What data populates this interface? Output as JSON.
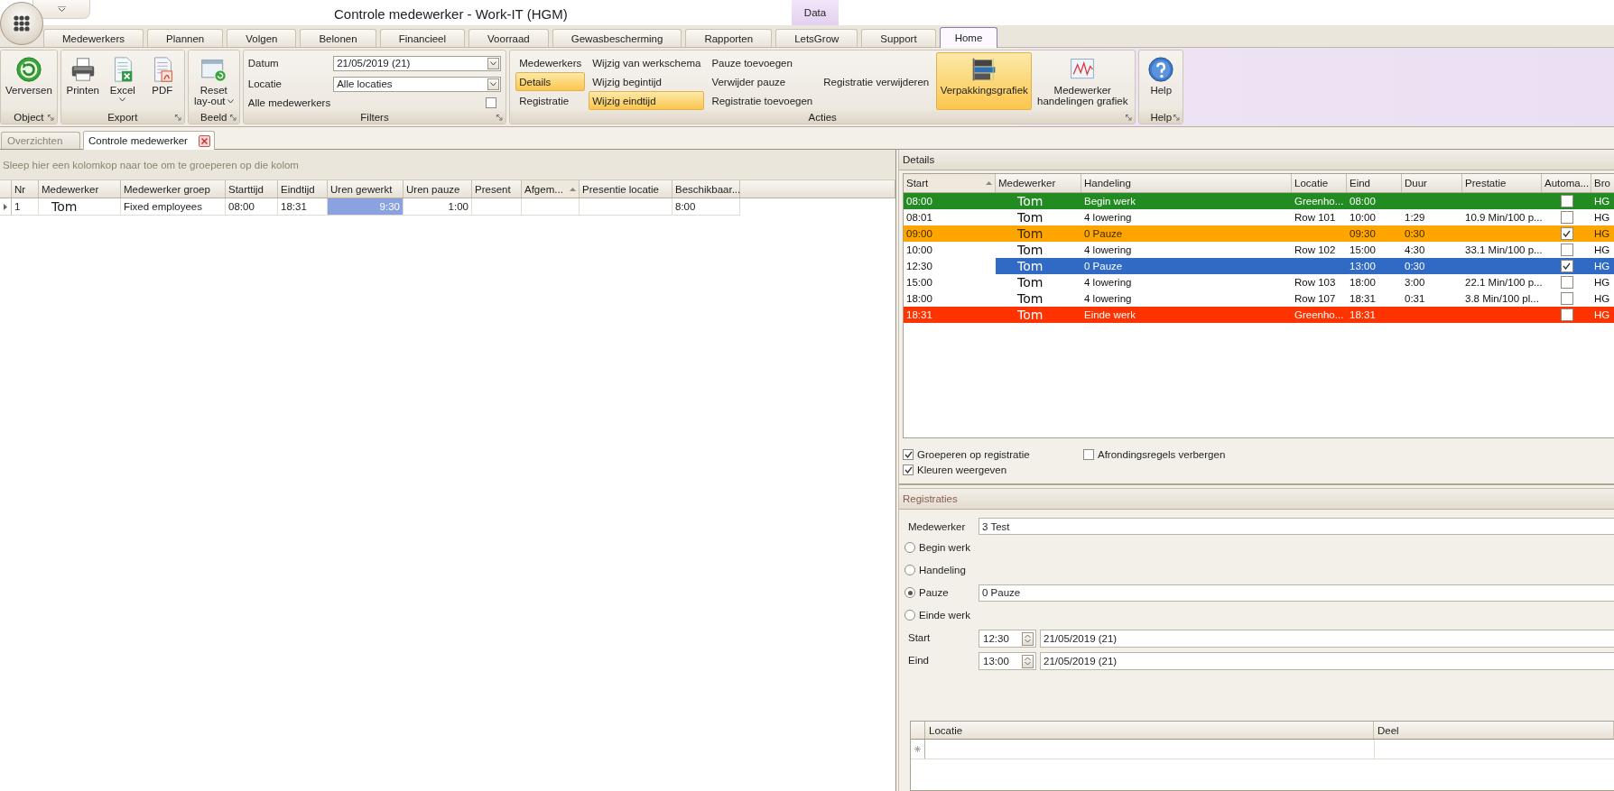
{
  "window": {
    "title": "Controle medewerker - Work-IT (HGM)",
    "contextual_tab": "Data"
  },
  "ribbon": {
    "tabs": [
      {
        "label": "Medewerkers",
        "selected": false
      },
      {
        "label": "Plannen",
        "selected": false
      },
      {
        "label": "Volgen",
        "selected": false
      },
      {
        "label": "Belonen",
        "selected": false
      },
      {
        "label": "Financieel",
        "selected": false
      },
      {
        "label": "Voorraad",
        "selected": false
      },
      {
        "label": "Gewasbescherming",
        "selected": false
      },
      {
        "label": "Rapporten",
        "selected": false
      },
      {
        "label": "LetsGrow",
        "selected": false
      },
      {
        "label": "Support",
        "selected": false
      },
      {
        "label": "Home",
        "selected": true
      }
    ],
    "groups": [
      {
        "title": "Object",
        "kind": "buttons",
        "buttons": [
          {
            "label": "Verversen",
            "dropdown": false,
            "highlighted": false
          }
        ]
      },
      {
        "title": "Export",
        "kind": "buttons",
        "buttons": [
          {
            "label": "Printen",
            "dropdown": false,
            "highlighted": false
          },
          {
            "label": "Excel",
            "dropdown": true,
            "highlighted": false
          },
          {
            "label": "PDF",
            "dropdown": false,
            "highlighted": false
          }
        ]
      },
      {
        "title": "Beeld",
        "kind": "buttons",
        "buttons": [
          {
            "label": "Reset lay-out",
            "dropdown": true,
            "highlighted": false
          }
        ]
      },
      {
        "title": "Filters",
        "kind": "filters",
        "fields": [
          {
            "label": "Datum",
            "value": "21/05/2019 (21)"
          },
          {
            "label": "Locatie",
            "value": "Alle locaties"
          }
        ],
        "checkbox": {
          "label": "Alle medewerkers",
          "checked": false
        }
      },
      {
        "title": "Acties",
        "kind": "actions",
        "columns": [
          [
            {
              "label": "Medewerkers",
              "highlighted": false
            },
            {
              "label": "Details",
              "highlighted": true
            },
            {
              "label": "Registratie",
              "highlighted": false
            }
          ],
          [
            {
              "label": "Wijzig van werkschema",
              "highlighted": false
            },
            {
              "label": "Wijzig begintijd",
              "highlighted": false
            },
            {
              "label": "Wijzig eindtijd",
              "highlighted": true
            }
          ],
          [
            {
              "label": "Pauze toevoegen",
              "highlighted": false
            },
            {
              "label": "Verwijder pauze",
              "highlighted": false
            },
            {
              "label": "Registratie toevoegen",
              "highlighted": false
            }
          ],
          [
            null,
            {
              "label": "Registratie verwijderen",
              "highlighted": false
            },
            null
          ]
        ],
        "buttons": [
          {
            "label": "Verpakkingsgrafiek",
            "dropdown": false,
            "highlighted": true
          },
          {
            "label": "Medewerker handelingen grafiek",
            "dropdown": false,
            "highlighted": false
          }
        ]
      },
      {
        "title": "Help",
        "kind": "buttons",
        "buttons": [
          {
            "label": "Help",
            "dropdown": false,
            "highlighted": false
          }
        ]
      }
    ]
  },
  "document_tabs": [
    {
      "label": "Overzichten",
      "selected": false,
      "closable": false
    },
    {
      "label": "Controle medewerker",
      "selected": true,
      "closable": true
    }
  ],
  "employees_table": {
    "group_hint": "Sleep hier een kolomkop naar toe om te groeperen op die kolom",
    "columns": [
      {
        "label": "Nr",
        "kind": "text",
        "sorted": false
      },
      {
        "label": "Medewerker",
        "kind": "name",
        "sorted": false
      },
      {
        "label": "Medewerker groep",
        "kind": "text",
        "sorted": false
      },
      {
        "label": "Starttijd",
        "kind": "text",
        "sorted": false
      },
      {
        "label": "Eindtijd",
        "kind": "text",
        "sorted": false
      },
      {
        "label": "Uren gewerkt",
        "kind": "duration",
        "sorted": false
      },
      {
        "label": "Uren pauze",
        "kind": "duration",
        "sorted": false
      },
      {
        "label": "Present",
        "kind": "text",
        "sorted": false
      },
      {
        "label": "Afgem...",
        "kind": "text",
        "sorted": true
      },
      {
        "label": "Presentie locatie",
        "kind": "text",
        "sorted": false
      },
      {
        "label": "Beschikbaar...",
        "kind": "text",
        "sorted": false
      }
    ],
    "rows": [
      {
        "current": true,
        "cells": [
          {
            "text": "1",
            "selected": false
          },
          {
            "text": "Tom",
            "selected": false
          },
          {
            "text": "Fixed employees",
            "selected": false
          },
          {
            "text": "08:00",
            "selected": false
          },
          {
            "text": "18:31",
            "selected": false
          },
          {
            "text": "9:30",
            "selected": true
          },
          {
            "text": "1:00",
            "selected": false
          },
          {
            "selected": false
          },
          {
            "selected": false
          },
          {
            "selected": false
          },
          {
            "text": "8:00",
            "selected": false
          }
        ]
      }
    ]
  },
  "details": {
    "title": "Details",
    "columns": [
      {
        "label": "Start",
        "sorted": true
      },
      {
        "label": "Medewerker",
        "sorted": false
      },
      {
        "label": "Handeling",
        "sorted": false
      },
      {
        "label": "Locatie",
        "sorted": false
      },
      {
        "label": "Eind",
        "sorted": false
      },
      {
        "label": "Duur",
        "sorted": false
      },
      {
        "label": "Prestatie",
        "sorted": false
      },
      {
        "label": "Automa...",
        "sorted": false
      },
      {
        "label": "Bro",
        "sorted": false
      }
    ],
    "rows": [
      {
        "color": "#228b22",
        "selected": false,
        "start": "08:00",
        "employee": "Tom",
        "action": "Begin werk",
        "location": "Greenho...",
        "end": "08:00",
        "automatic": false,
        "source": "HG"
      },
      {
        "color": "#ffffff",
        "selected": false,
        "start": "08:01",
        "employee": "Tom",
        "action": "4 lowering",
        "location": "Row 101",
        "end": "10:00",
        "duration": "1:29",
        "performance": "10.9 Min/100 p...",
        "automatic": false,
        "source": "HG"
      },
      {
        "color": "#ffa500",
        "selected": false,
        "start": "09:00",
        "employee": "Tom",
        "action": "0 Pauze",
        "end": "09:30",
        "duration": "0:30",
        "automatic": true,
        "source": "HG"
      },
      {
        "color": "#ffffff",
        "selected": false,
        "start": "10:00",
        "employee": "Tom",
        "action": "4 lowering",
        "location": "Row 102",
        "end": "15:00",
        "duration": "4:30",
        "performance": "33.1 Min/100 p...",
        "automatic": false,
        "source": "HG"
      },
      {
        "color": "#ffffff",
        "selected": true,
        "start": "12:30",
        "employee": "Tom",
        "action": "0 Pauze",
        "end": "13:00",
        "duration": "0:30",
        "automatic": true,
        "source": "HG"
      },
      {
        "color": "#ffffff",
        "selected": false,
        "start": "15:00",
        "employee": "Tom",
        "action": "4 lowering",
        "location": "Row 103",
        "end": "18:00",
        "duration": "3:00",
        "performance": "22.1 Min/100 p...",
        "automatic": false,
        "source": "HG"
      },
      {
        "color": "#ffffff",
        "selected": false,
        "start": "18:00",
        "employee": "Tom",
        "action": "4 lowering",
        "location": "Row 107",
        "end": "18:31",
        "duration": "0:31",
        "performance": "3.8 Min/100 pl...",
        "automatic": false,
        "source": "HG"
      },
      {
        "color": "#ff3300",
        "selected": false,
        "start": "18:31",
        "employee": "Tom",
        "action": "Einde werk",
        "location": "Greenho...",
        "end": "18:31",
        "automatic": false,
        "source": "HG"
      }
    ],
    "options": [
      {
        "label": "Groeperen op registratie",
        "checked": true
      },
      {
        "label": "Afrondingsregels verbergen",
        "checked": false
      },
      {
        "label": "Kleuren weergeven",
        "checked": true
      }
    ]
  },
  "registrations": {
    "title": "Registraties",
    "employee": {
      "label": "Medewerker",
      "value": "3 Test"
    },
    "types": [
      {
        "label": "Begin werk",
        "selected": false
      },
      {
        "label": "Handeling",
        "selected": false
      },
      {
        "label": "Pauze",
        "selected": true,
        "value": "0 Pauze"
      },
      {
        "label": "Einde werk",
        "selected": false
      }
    ],
    "times": [
      {
        "label": "Start",
        "time": "12:30",
        "date": "21/05/2019 (21)"
      },
      {
        "label": "Eind",
        "time": "13:00",
        "date": "21/05/2019 (21)"
      }
    ],
    "locations_table": {
      "columns": [
        "Locatie",
        "Deel"
      ]
    }
  }
}
